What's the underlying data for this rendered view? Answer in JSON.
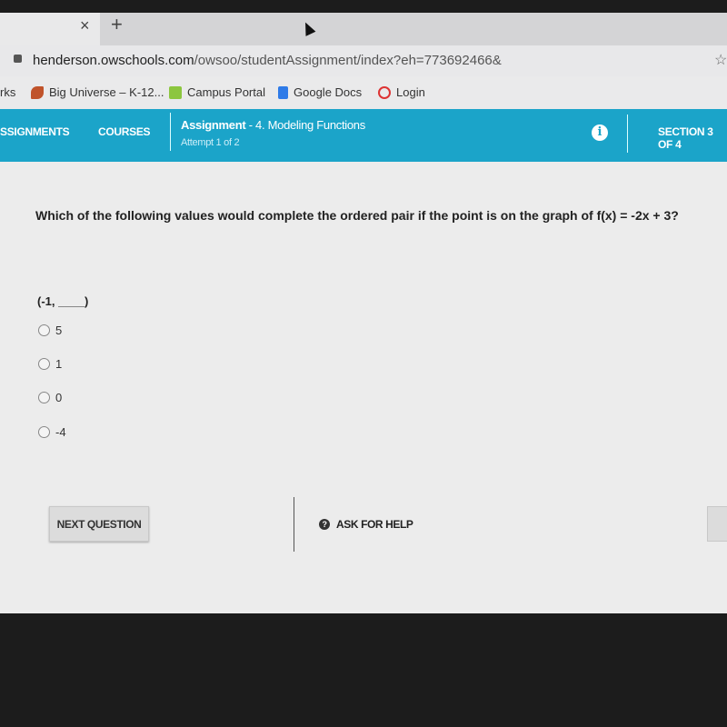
{
  "browser": {
    "tab_close": "×",
    "new_tab": "+",
    "url_host": "henderson.owschools.com",
    "url_path": "/owsoo/studentAssignment/index?eh=773692466&",
    "bookmarks": [
      {
        "label": "rks",
        "icon": "bookmark"
      },
      {
        "label": "Big Universe – K-12...",
        "icon": "big-universe-icon"
      },
      {
        "label": "Campus Portal",
        "icon": "campus-portal-icon"
      },
      {
        "label": "Google Docs",
        "icon": "google-docs-icon"
      },
      {
        "label": "Login",
        "icon": "login-icon"
      }
    ]
  },
  "nav": {
    "assignments": "SSIGNMENTS",
    "courses": "COURSES",
    "assignment_label": "Assignment",
    "assignment_name": "- 4. Modeling Functions",
    "attempt": "Attempt 1 of 2",
    "section": "SECTION 3 OF 4",
    "info_icon": "i"
  },
  "question": {
    "text": "Which of the following values would complete the ordered pair if the point is on the graph of f(x) = -2x + 3?",
    "pair": "(-1, ____)",
    "options": [
      "5",
      "1",
      "0",
      "-4"
    ]
  },
  "footer": {
    "next": "NEXT QUESTION",
    "help": "ASK FOR HELP",
    "help_icon": "?"
  },
  "colors": {
    "nav": "#1ba4c9"
  }
}
